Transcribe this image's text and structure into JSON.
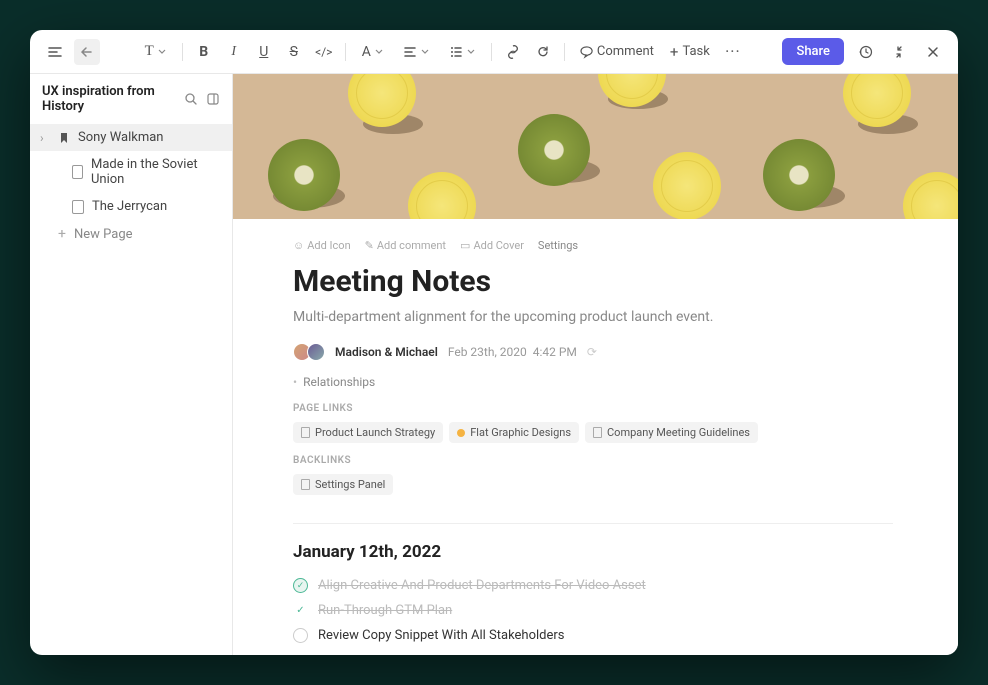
{
  "sidebar": {
    "title": "UX inspiration from History",
    "items": [
      {
        "label": "Sony Walkman"
      },
      {
        "label": "Made in the Soviet Union"
      },
      {
        "label": "The Jerrycan"
      }
    ],
    "new_page": "New Page"
  },
  "toolbar": {
    "comment": "Comment",
    "task": "Task",
    "share": "Share"
  },
  "meta": {
    "add_icon": "Add Icon",
    "add_comment": "Add comment",
    "add_cover": "Add Cover",
    "settings": "Settings"
  },
  "page": {
    "title": "Meeting Notes",
    "subtitle": "Multi-department alignment for the upcoming product launch event.",
    "authors": "Madison & Michael",
    "date": "Feb 23th, 2020",
    "time": "4:42 PM",
    "relationships": "Relationships"
  },
  "page_links": {
    "label": "PAGE LINKS",
    "items": [
      "Product Launch Strategy",
      "Flat Graphic Designs",
      "Company Meeting Guidelines"
    ]
  },
  "backlinks": {
    "label": "BACKLINKS",
    "items": [
      "Settings Panel"
    ]
  },
  "section_date": "January 12th, 2022",
  "tasks": [
    {
      "text": "Align Creative And Product Departments For Video Asset"
    },
    {
      "text": "Run-Through GTM Plan"
    },
    {
      "text": "Review Copy Snippet With All Stakeholders"
    }
  ]
}
